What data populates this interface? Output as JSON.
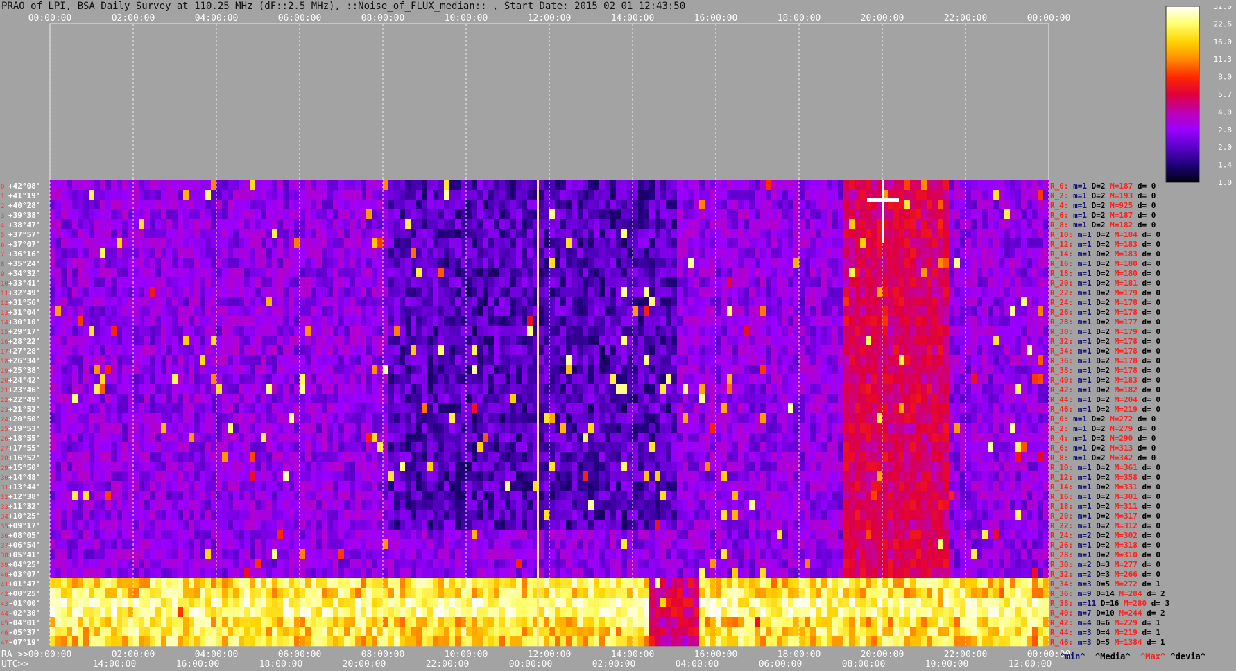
{
  "title": "PRAO of LPI, BSA Daily Survey at 110.25 MHz (dF::2.5 MHz), ::Noise_of_FLUX_median:: , Start Date: 2015 02 01 12:43:50",
  "top_time_labels": [
    "00:00:00",
    "02:00:00",
    "04:00:00",
    "06:00:00",
    "08:00:00",
    "10:00:00",
    "12:00:00",
    "14:00:00",
    "16:00:00",
    "18:00:00",
    "20:00:00",
    "22:00:00",
    "00:00:00"
  ],
  "bottom_ra_prefix": "RA >>",
  "bottom_ra_labels": [
    "00:00:00",
    "02:00:00",
    "04:00:00",
    "06:00:00",
    "08:00:00",
    "10:00:00",
    "12:00:00",
    "14:00:00",
    "16:00:00",
    "18:00:00",
    "20:00:00",
    "22:00:00",
    "00:00:00"
  ],
  "bottom_utc_prefix": "UTC>>",
  "bottom_utc_labels": [
    "14:00:00",
    "16:00:00",
    "18:00:00",
    "20:00:00",
    "22:00:00",
    "00:00:00",
    "02:00:00",
    "04:00:00",
    "06:00:00",
    "08:00:00",
    "10:00:00",
    "12:00:00"
  ],
  "declinations": [
    "+42°08'",
    "+41°19'",
    "+40°28'",
    "+39°38'",
    "+38°47'",
    "+37°57'",
    "+37°07'",
    "+36°16'",
    "+35°24'",
    "+34°32'",
    "+33°41'",
    "+32°49'",
    "+31°56'",
    "+31°04'",
    "+30°10'",
    "+29°17'",
    "+28°22'",
    "+27°28'",
    "+26°34'",
    "+25°38'",
    "+24°42'",
    "+23°46'",
    "+22°49'",
    "+21°52'",
    "+20°50'",
    "+19°53'",
    "+18°55'",
    "+17°55'",
    "+16°52'",
    "+15°50'",
    "+14°48'",
    "+13°44'",
    "+12°38'",
    "+11°32'",
    "+10°25'",
    "+09°17'",
    "+08°05'",
    "+06°54'",
    "+05°41'",
    "+04°25'",
    "+03°07'",
    "+01°47'",
    "+00°25'",
    "-01°00'",
    "-02°30'",
    "-04°01'",
    "-05°37'",
    "-07°19'"
  ],
  "row_indices": [
    "0",
    "1",
    "2",
    "3",
    "4",
    "5",
    "6",
    "7",
    "8",
    "9",
    "10",
    "11",
    "12",
    "13",
    "14",
    "15",
    "16",
    "17",
    "18",
    "19",
    "20",
    "21",
    "22",
    "23",
    "24",
    "25",
    "26",
    "27",
    "28",
    "29",
    "30",
    "31",
    "32",
    "33",
    "34",
    "35",
    "36",
    "37",
    "38",
    "39",
    "40",
    "41",
    "42",
    "43",
    "44",
    "45",
    "46",
    "47"
  ],
  "stats_rows": [
    {
      "r": "R_0:",
      "m": "m=1",
      "D": "D=2",
      "M": "M=187",
      "d": "d= 0"
    },
    {
      "r": "R_2:",
      "m": "m=1",
      "D": "D=2",
      "M": "M=193",
      "d": "d= 0"
    },
    {
      "r": "R_4:",
      "m": "m=1",
      "D": "D=2",
      "M": "M=925",
      "d": "d= 0"
    },
    {
      "r": "R_6:",
      "m": "m=1",
      "D": "D=2",
      "M": "M=187",
      "d": "d= 0"
    },
    {
      "r": "R_8:",
      "m": "m=1",
      "D": "D=2",
      "M": "M=182",
      "d": "d= 0"
    },
    {
      "r": "R_10:",
      "m": "m=1",
      "D": "D=2",
      "M": "M=184",
      "d": "d= 0"
    },
    {
      "r": "R_12:",
      "m": "m=1",
      "D": "D=2",
      "M": "M=183",
      "d": "d= 0"
    },
    {
      "r": "R_14:",
      "m": "m=1",
      "D": "D=2",
      "M": "M=183",
      "d": "d= 0"
    },
    {
      "r": "R_16:",
      "m": "m=1",
      "D": "D=2",
      "M": "M=180",
      "d": "d= 0"
    },
    {
      "r": "R_18:",
      "m": "m=1",
      "D": "D=2",
      "M": "M=180",
      "d": "d= 0"
    },
    {
      "r": "R_20:",
      "m": "m=1",
      "D": "D=2",
      "M": "M=181",
      "d": "d= 0"
    },
    {
      "r": "R_22:",
      "m": "m=1",
      "D": "D=2",
      "M": "M=179",
      "d": "d= 0"
    },
    {
      "r": "R_24:",
      "m": "m=1",
      "D": "D=2",
      "M": "M=178",
      "d": "d= 0"
    },
    {
      "r": "R_26:",
      "m": "m=1",
      "D": "D=2",
      "M": "M=178",
      "d": "d= 0"
    },
    {
      "r": "R_28:",
      "m": "m=1",
      "D": "D=2",
      "M": "M=177",
      "d": "d= 0"
    },
    {
      "r": "R_30:",
      "m": "m=1",
      "D": "D=2",
      "M": "M=179",
      "d": "d= 0"
    },
    {
      "r": "R_32:",
      "m": "m=1",
      "D": "D=2",
      "M": "M=178",
      "d": "d= 0"
    },
    {
      "r": "R_34:",
      "m": "m=1",
      "D": "D=2",
      "M": "M=178",
      "d": "d= 0"
    },
    {
      "r": "R_36:",
      "m": "m=1",
      "D": "D=2",
      "M": "M=178",
      "d": "d= 0"
    },
    {
      "r": "R_38:",
      "m": "m=1",
      "D": "D=2",
      "M": "M=178",
      "d": "d= 0"
    },
    {
      "r": "R_40:",
      "m": "m=1",
      "D": "D=2",
      "M": "M=183",
      "d": "d= 0"
    },
    {
      "r": "R_42:",
      "m": "m=1",
      "D": "D=2",
      "M": "M=182",
      "d": "d= 0"
    },
    {
      "r": "R_44:",
      "m": "m=1",
      "D": "D=2",
      "M": "M=204",
      "d": "d= 0"
    },
    {
      "r": "R_46:",
      "m": "m=1",
      "D": "D=2",
      "M": "M=219",
      "d": "d= 0"
    },
    {
      "r": "R_0:",
      "m": "m=1",
      "D": "D=2",
      "M": "M=272",
      "d": "d= 0"
    },
    {
      "r": "R_2:",
      "m": "m=1",
      "D": "D=2",
      "M": "M=279",
      "d": "d= 0"
    },
    {
      "r": "R_4:",
      "m": "m=1",
      "D": "D=2",
      "M": "M=290",
      "d": "d= 0"
    },
    {
      "r": "R_6:",
      "m": "m=1",
      "D": "D=2",
      "M": "M=313",
      "d": "d= 0"
    },
    {
      "r": "R_8:",
      "m": "m=1",
      "D": "D=2",
      "M": "M=342",
      "d": "d= 0"
    },
    {
      "r": "R_10:",
      "m": "m=1",
      "D": "D=2",
      "M": "M=361",
      "d": "d= 0"
    },
    {
      "r": "R_12:",
      "m": "m=1",
      "D": "D=2",
      "M": "M=358",
      "d": "d= 0"
    },
    {
      "r": "R_14:",
      "m": "m=1",
      "D": "D=2",
      "M": "M=331",
      "d": "d= 0"
    },
    {
      "r": "R_16:",
      "m": "m=1",
      "D": "D=2",
      "M": "M=301",
      "d": "d= 0"
    },
    {
      "r": "R_18:",
      "m": "m=1",
      "D": "D=2",
      "M": "M=311",
      "d": "d= 0"
    },
    {
      "r": "R_20:",
      "m": "m=1",
      "D": "D=2",
      "M": "M=317",
      "d": "d= 0"
    },
    {
      "r": "R_22:",
      "m": "m=1",
      "D": "D=2",
      "M": "M=312",
      "d": "d= 0"
    },
    {
      "r": "R_24:",
      "m": "m=2",
      "D": "D=2",
      "M": "M=302",
      "d": "d= 0"
    },
    {
      "r": "R_26:",
      "m": "m=1",
      "D": "D=2",
      "M": "M=318",
      "d": "d= 0"
    },
    {
      "r": "R_28:",
      "m": "m=1",
      "D": "D=2",
      "M": "M=310",
      "d": "d= 0"
    },
    {
      "r": "R_30:",
      "m": "m=2",
      "D": "D=3",
      "M": "M=277",
      "d": "d= 0"
    },
    {
      "r": "R_32:",
      "m": "m=2",
      "D": "D=3",
      "M": "M=266",
      "d": "d= 0"
    },
    {
      "r": "R_34:",
      "m": "m=3",
      "D": "D=5",
      "M": "M=272",
      "d": "d= 1"
    },
    {
      "r": "R_36:",
      "m": "m=9",
      "D": "D=14",
      "M": "M=284",
      "d": "d= 2"
    },
    {
      "r": "R_38:",
      "m": "m=11",
      "D": "D=16",
      "M": "M=280",
      "d": "d= 3"
    },
    {
      "r": "R_40:",
      "m": "m=7",
      "D": "D=10",
      "M": "M=244",
      "d": "d= 2"
    },
    {
      "r": "R_42:",
      "m": "m=4",
      "D": "D=6",
      "M": "M=229",
      "d": "d= 1"
    },
    {
      "r": "R_44:",
      "m": "m=3",
      "D": "D=4",
      "M": "M=219",
      "d": "d= 1"
    },
    {
      "r": "R_46:",
      "m": "m=3",
      "D": "D=5",
      "M": "M=1384",
      "d": "d= 1"
    }
  ],
  "legend_footer": {
    "min": "^min^",
    "media": "^Media^",
    "max": "^Max^",
    "devia": "^devia^"
  },
  "colorbar": {
    "tick_labels": [
      "32.0",
      "22.6",
      "16.0",
      "11.3",
      "8.0",
      "5.7",
      "4.0",
      "2.8",
      "2.0",
      "1.4",
      "1.0"
    ],
    "colors": [
      "#ffffff",
      "#ffff70",
      "#ffd400",
      "#ff8c00",
      "#ff2a00",
      "#e0003a",
      "#c000b0",
      "#9a00ff",
      "#5a00c8",
      "#20007a",
      "#000010"
    ]
  },
  "colors": {
    "background": "#a3a3a3",
    "stat_red": "#ff2020",
    "stat_navy": "#101070",
    "stat_black": "#000000",
    "row_index_red": "#ff3030"
  },
  "chart_data": {
    "type": "heatmap",
    "x_axis_top": "RA (hours)",
    "x_range_hours": [
      0,
      24
    ],
    "rows": 48,
    "hot_band_rows": [
      41,
      42,
      43,
      44,
      45,
      46,
      47
    ],
    "color_scale": "log2",
    "value_range": [
      1.0,
      32.0
    ]
  }
}
